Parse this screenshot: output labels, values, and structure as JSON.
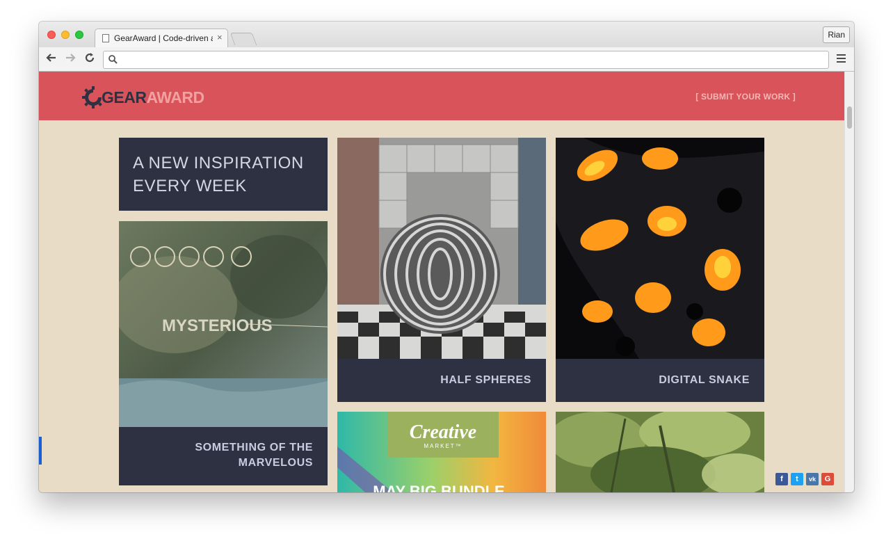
{
  "browser": {
    "tab_title": "GearAward | Code-driven a",
    "tab_close": "×",
    "profile_name": "Rian",
    "omnibox_value": "",
    "icons": [
      "back-arrow-icon",
      "forward-arrow-icon",
      "reload-icon",
      "search-icon",
      "hamburger-menu-icon",
      "document-icon"
    ]
  },
  "site": {
    "logo_gear": "GEAR",
    "logo_award": "AWARD",
    "submit_link": "[ SUBMIT YOUR WORK ]",
    "banner_text": "A NEW INSPIRATION EVERY WEEK",
    "cards": [
      {
        "caption": "SOMETHING OF THE MARVELOUS",
        "image_text": "MYSTERIOUS"
      },
      {
        "caption": "HALF SPHERES"
      },
      {
        "caption": "DIGITAL SNAKE"
      },
      {
        "image_text_logo": "Creative",
        "image_text_sub": "MARKET™",
        "image_text_bundle": "MAY BIG BUNDLE"
      },
      {
        "caption": ""
      }
    ],
    "social": [
      "f",
      "t",
      "vk",
      "G"
    ]
  },
  "colors": {
    "header": "#d9535a",
    "background": "#e8dcc6",
    "panel": "#2e3142",
    "caption_text": "#c9cce0"
  }
}
